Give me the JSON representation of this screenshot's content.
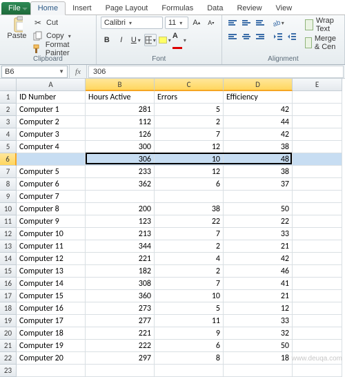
{
  "tabs": {
    "file": "File",
    "home": "Home",
    "insert": "Insert",
    "pageLayout": "Page Layout",
    "formulas": "Formulas",
    "data": "Data",
    "review": "Review",
    "view": "View"
  },
  "ribbon": {
    "clipboard": {
      "label": "Clipboard",
      "paste": "Paste",
      "cut": "Cut",
      "copy": "Copy",
      "formatPainter": "Format Painter"
    },
    "font": {
      "label": "Font",
      "family": "Calibri",
      "size": "11"
    },
    "alignment": {
      "label": "Alignment",
      "wrap": "Wrap Text",
      "merge": "Merge & Cen"
    }
  },
  "nameBox": "B6",
  "formula": "306",
  "columns": [
    "A",
    "B",
    "C",
    "D",
    "E"
  ],
  "headers": {
    "a": "ID Number",
    "b": "Hours Active",
    "c": "Errors",
    "d": "Efficiency"
  },
  "selectedRow": 6,
  "rows": [
    {
      "n": 1,
      "a": "ID Number",
      "b": "Hours Active",
      "c": "Errors",
      "d": "Efficiency",
      "isHeader": true
    },
    {
      "n": 2,
      "a": "Computer 1",
      "b": 281,
      "c": 5,
      "d": 42
    },
    {
      "n": 3,
      "a": "Computer 2",
      "b": 112,
      "c": 2,
      "d": 44
    },
    {
      "n": 4,
      "a": "Computer 3",
      "b": 126,
      "c": 7,
      "d": 42
    },
    {
      "n": 5,
      "a": "Computer 4",
      "b": 300,
      "c": 12,
      "d": 38
    },
    {
      "n": 6,
      "a": "",
      "b": 306,
      "c": 10,
      "d": 48
    },
    {
      "n": 7,
      "a": "Computer 5",
      "b": 233,
      "c": 12,
      "d": 38
    },
    {
      "n": 8,
      "a": "Computer 6",
      "b": 362,
      "c": 6,
      "d": 37
    },
    {
      "n": 9,
      "a": "Computer 7",
      "b": "",
      "c": "",
      "d": ""
    },
    {
      "n": 10,
      "a": "Computer 8",
      "b": 200,
      "c": 38,
      "d": 50
    },
    {
      "n": 11,
      "a": "Computer 9",
      "b": 123,
      "c": 22,
      "d": 22
    },
    {
      "n": 12,
      "a": "Computer 10",
      "b": 213,
      "c": 7,
      "d": 33
    },
    {
      "n": 13,
      "a": "Computer 11",
      "b": 344,
      "c": 2,
      "d": 21
    },
    {
      "n": 14,
      "a": "Computer 12",
      "b": 221,
      "c": 4,
      "d": 42
    },
    {
      "n": 15,
      "a": "Computer 13",
      "b": 182,
      "c": 2,
      "d": 46
    },
    {
      "n": 16,
      "a": "Computer 14",
      "b": 308,
      "c": 7,
      "d": 41
    },
    {
      "n": 17,
      "a": "Computer 15",
      "b": 360,
      "c": 10,
      "d": 21
    },
    {
      "n": 18,
      "a": "Computer 16",
      "b": 273,
      "c": 5,
      "d": 12
    },
    {
      "n": 19,
      "a": "Computer 17",
      "b": 277,
      "c": 11,
      "d": 33
    },
    {
      "n": 20,
      "a": "Computer 18",
      "b": 221,
      "c": 9,
      "d": 32
    },
    {
      "n": 21,
      "a": "Computer 19",
      "b": 222,
      "c": 6,
      "d": 50
    },
    {
      "n": 22,
      "a": "Computer 20",
      "b": 297,
      "c": 8,
      "d": 18
    },
    {
      "n": 23,
      "a": "",
      "b": "",
      "c": "",
      "d": ""
    }
  ],
  "watermark": "www.deuqa.com"
}
